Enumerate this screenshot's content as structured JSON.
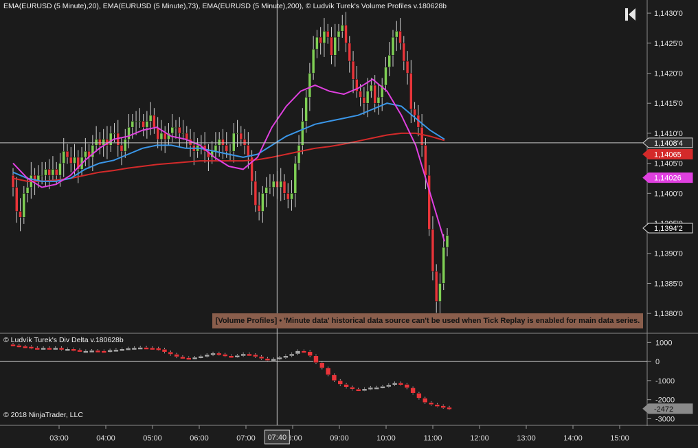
{
  "header": {
    "indicators_title": "EMA(EURUSD (5 Minute),20), EMA(EURUSD (5 Minute),73), EMA(EURUSD (5 Minute),200), © Ludvík Turek's Volume Profiles v.180628b"
  },
  "subpanel": {
    "title": "© Ludvík Turek's Div Delta v.180628b"
  },
  "footer": {
    "copyright": "© 2018 NinjaTrader, LLC"
  },
  "warning": {
    "text": "[Volume Profiles] • 'Minute data' historical data source can't be used when Tick Replay is enabled for main data series."
  },
  "crosshair": {
    "time_label": "07:40",
    "price_label": "1,1408'4"
  },
  "colors": {
    "up": "#7fcf55",
    "down": "#e8353a",
    "ema20": "#e040e0",
    "ema73": "#3a96e8",
    "ema200": "#d42a2a",
    "background": "#1b1b1b",
    "warning_bg": "#8a5e4c"
  },
  "chart_data": [
    {
      "type": "candlestick",
      "instrument": "EURUSD",
      "interval": "5 Minute",
      "y_ticks": [
        "1,1430'0",
        "1,1425'0",
        "1,1420'0",
        "1,1415'0",
        "1,1410'0",
        "1,1405'0",
        "1,1400'0",
        "1,1395'0",
        "1,1390'0",
        "1,1385'0",
        "1,1380'0"
      ],
      "y_tick_values": [
        1.143,
        1.1425,
        1.142,
        1.1415,
        1.141,
        1.1405,
        1.14,
        1.1395,
        1.139,
        1.1385,
        1.138
      ],
      "ylim": [
        1.13775,
        1.14315
      ],
      "x_ticks": [
        "03:00",
        "04:00",
        "05:00",
        "06:00",
        "07:00",
        "08:00",
        "09:00",
        "10:00",
        "11:00",
        "12:00",
        "13:00",
        "14:00",
        "15:00"
      ],
      "time_range_hours": [
        2.14,
        15.25
      ],
      "closes": [
        1.1401,
        1.1397,
        1.1396,
        1.14,
        1.1401,
        1.1403,
        1.1402,
        1.1403,
        1.1403,
        1.1404,
        1.1403,
        1.1404,
        1.1403,
        1.1405,
        1.1407,
        1.1406,
        1.1405,
        1.1406,
        1.1404,
        1.1406,
        1.1407,
        1.1406,
        1.1408,
        1.1409,
        1.1408,
        1.1409,
        1.1408,
        1.141,
        1.141,
        1.1408,
        1.1407,
        1.1409,
        1.1411,
        1.1412,
        1.1412,
        1.1412,
        1.1411,
        1.1412,
        1.1413,
        1.1411,
        1.1409,
        1.141,
        1.1409,
        1.141,
        1.1411,
        1.1411,
        1.141,
        1.141,
        1.1409,
        1.1408,
        1.1407,
        1.1408,
        1.1408,
        1.1407,
        1.1406,
        1.1407,
        1.1408,
        1.1409,
        1.1408,
        1.1407,
        1.1407,
        1.141,
        1.141,
        1.1409,
        1.1408,
        1.1406,
        1.1402,
        1.1398,
        1.1397,
        1.14,
        1.1401,
        1.1401,
        1.1402,
        1.1401,
        1.1402,
        1.14,
        1.1399,
        1.14,
        1.1405,
        1.1408,
        1.1412,
        1.1416,
        1.142,
        1.1424,
        1.1426,
        1.1425,
        1.1427,
        1.1426,
        1.1423,
        1.1426,
        1.1427,
        1.1428,
        1.1425,
        1.1422,
        1.1419,
        1.1417,
        1.1416,
        1.1415,
        1.1417,
        1.1418,
        1.1415,
        1.1416,
        1.1418,
        1.1421,
        1.1423,
        1.1426,
        1.1427,
        1.1425,
        1.1422,
        1.142,
        1.1414,
        1.1413,
        1.1411,
        1.1408,
        1.1403,
        1.1394,
        1.1387,
        1.1382,
        1.1385,
        1.1391,
        1.1393
      ],
      "open_first": 1.1403,
      "ema20": [
        1.1405,
        1.14025,
        1.1401,
        1.14015,
        1.1403,
        1.14055,
        1.14075,
        1.1409,
        1.14095,
        1.14105,
        1.1411,
        1.14095,
        1.1409,
        1.1408,
        1.1406,
        1.14045,
        1.1404,
        1.1406,
        1.1411,
        1.14145,
        1.1417,
        1.1418,
        1.1417,
        1.14165,
        1.14175,
        1.1419,
        1.1417,
        1.1413,
        1.1408,
        1.14,
        1.1392
      ],
      "ema73": [
        1.14035,
        1.14025,
        1.1402,
        1.1402,
        1.14025,
        1.1404,
        1.1405,
        1.14055,
        1.14065,
        1.14075,
        1.1408,
        1.1408,
        1.14075,
        1.14075,
        1.1407,
        1.14065,
        1.1406,
        1.14065,
        1.1408,
        1.14095,
        1.14105,
        1.14115,
        1.1412,
        1.14125,
        1.1413,
        1.1414,
        1.1415,
        1.14145,
        1.14125,
        1.14105,
        1.1409
      ],
      "ema200": [
        1.14025,
        1.1402,
        1.1402,
        1.14022,
        1.14025,
        1.1403,
        1.14035,
        1.14038,
        1.14042,
        1.14045,
        1.14048,
        1.1405,
        1.14052,
        1.14054,
        1.14054,
        1.14054,
        1.14054,
        1.14056,
        1.1406,
        1.14065,
        1.1407,
        1.14075,
        1.14078,
        1.14082,
        1.14087,
        1.14092,
        1.14097,
        1.141,
        1.141,
        1.14095,
        1.14088
      ],
      "series": [
        {
          "name": "EMA(EURUSD (5 Minute),20)",
          "last_value_label": "1,14026"
        },
        {
          "name": "EMA(EURUSD (5 Minute),73)",
          "last_value_label": "1,1408'4"
        },
        {
          "name": "EMA(EURUSD (5 Minute),200)",
          "last_value_label": "1,14065"
        }
      ],
      "last_price_label": "1,1394'2"
    },
    {
      "type": "bar",
      "title": "© Ludvík Turek's Div Delta v.180628b",
      "y_ticks": [
        "1000",
        "0",
        "-1000",
        "-2000",
        "-3000"
      ],
      "y_tick_values": [
        1000,
        0,
        -1000,
        -2000,
        -3000
      ],
      "ylim": [
        -3200,
        1300
      ],
      "values": [
        850,
        800,
        780,
        720,
        700,
        720,
        680,
        720,
        640,
        660,
        610,
        560,
        560,
        580,
        560,
        540,
        600,
        620,
        660,
        700,
        720,
        740,
        720,
        700,
        640,
        500,
        380,
        250,
        200,
        180,
        220,
        280,
        360,
        440,
        380,
        300,
        260,
        320,
        400,
        360,
        260,
        160,
        100,
        140,
        220,
        300,
        400,
        560,
        520,
        300,
        -60,
        -340,
        -700,
        -1000,
        -1200,
        -1340,
        -1450,
        -1480,
        -1430,
        -1360,
        -1350,
        -1300,
        -1220,
        -1120,
        -1200,
        -1380,
        -1660,
        -1920,
        -2150,
        -2250,
        -2320,
        -2400,
        -2472
      ],
      "last_value_label": "-2472"
    }
  ]
}
